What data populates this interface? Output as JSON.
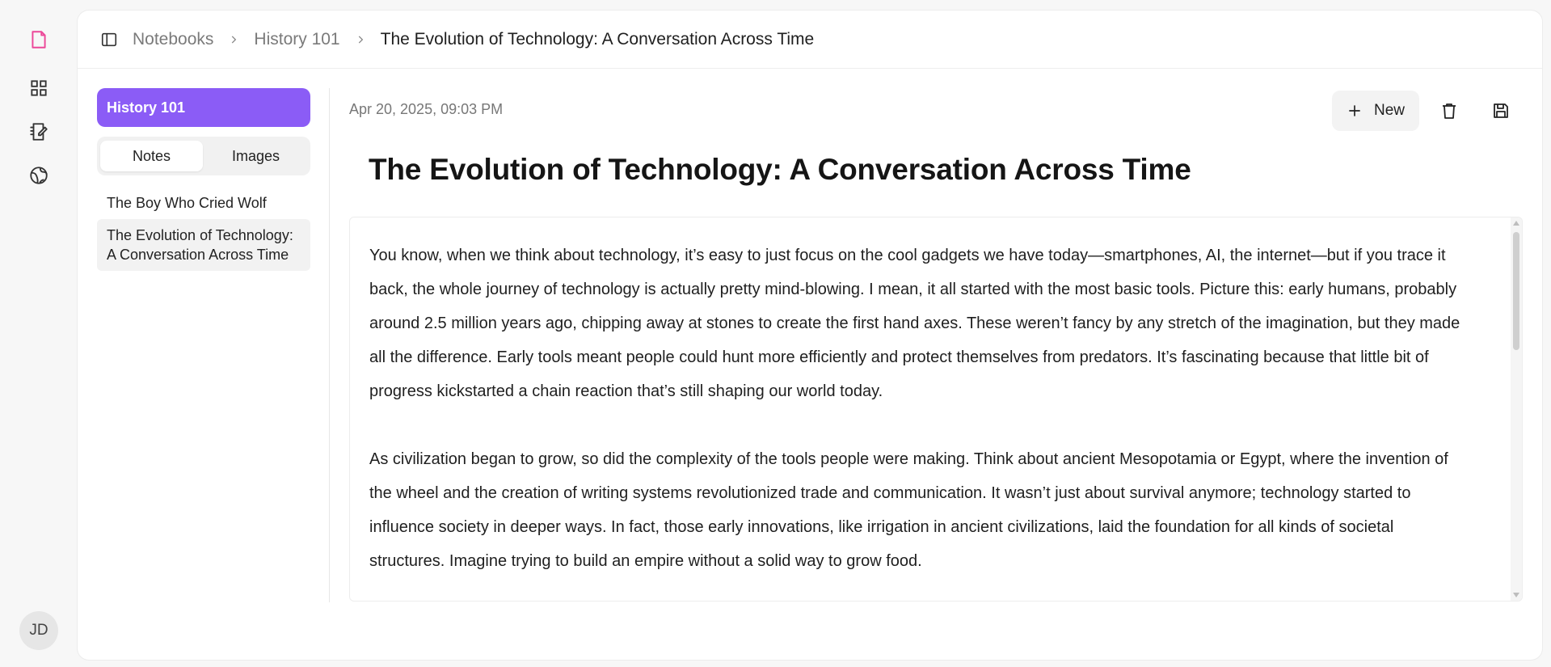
{
  "rail": {
    "icons": [
      "document-icon",
      "grid-icon",
      "notebook-edit-icon",
      "globe-icon"
    ],
    "active_color": "#ec4899",
    "avatar_initials": "JD"
  },
  "breadcrumb": {
    "items": [
      "Notebooks",
      "History 101",
      "The Evolution of Technology: A Conversation Across Time"
    ]
  },
  "sidebar": {
    "notebook_title": "History 101",
    "accent_color": "#8b5cf6",
    "tabs": [
      {
        "label": "Notes",
        "active": true
      },
      {
        "label": "Images",
        "active": false
      }
    ],
    "notes": [
      {
        "title": "The Boy Who Cried Wolf",
        "selected": false
      },
      {
        "title": "The Evolution of Technology: A Conversation Across Time",
        "selected": true
      }
    ]
  },
  "editor": {
    "timestamp": "Apr 20, 2025, 09:03 PM",
    "new_label": "New",
    "title": "The Evolution of Technology: A Conversation Across Time",
    "paragraphs": [
      "You know, when we think about technology, it’s easy to just focus on the cool gadgets we have today—smartphones, AI, the internet—but if you trace it back, the whole journey of technology is actually pretty mind-blowing. I mean, it all started with the most basic tools. Picture this: early humans, probably around 2.5 million years ago, chipping away at stones to create the first hand axes. These weren’t fancy by any stretch of the imagination, but they made all the difference. Early tools meant people could hunt more efficiently and protect themselves from predators. It’s fascinating because that little bit of progress kickstarted a chain reaction that’s still shaping our world today.",
      "As civilization began to grow, so did the complexity of the tools people were making. Think about ancient Mesopotamia or Egypt, where the invention of the wheel and the creation of writing systems revolutionized trade and communication. It wasn’t just about survival anymore; technology started to influence society in deeper ways. In fact, those early innovations, like irrigation in ancient civilizations, laid the foundation for all kinds of societal structures. Imagine trying to build an empire without a solid way to grow food."
    ]
  }
}
